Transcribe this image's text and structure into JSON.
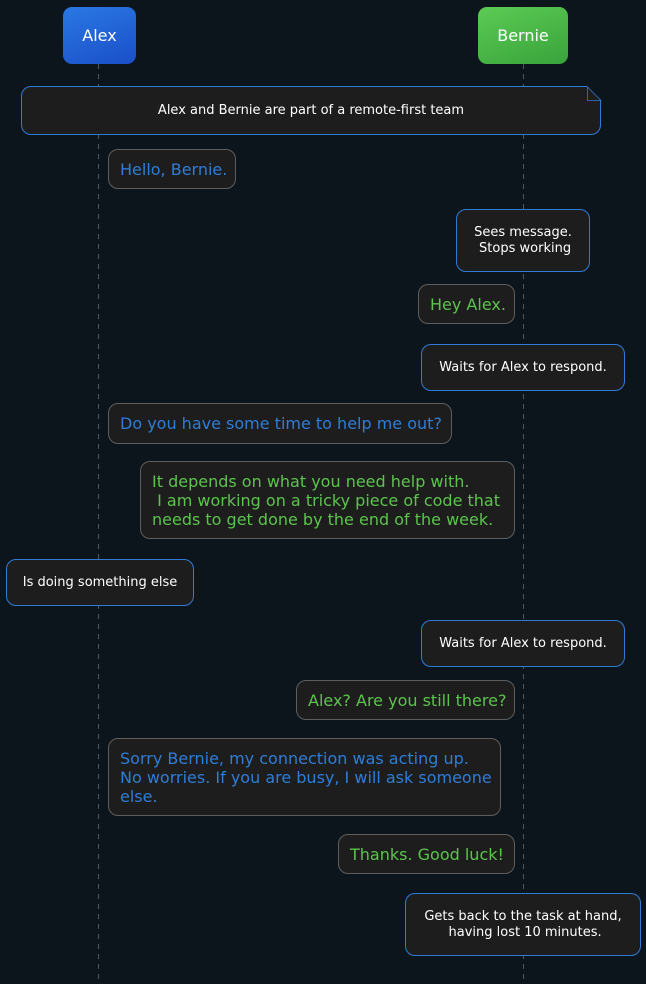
{
  "participants": {
    "alex": "Alex",
    "bernie": "Bernie"
  },
  "steps": [
    {
      "type": "note",
      "text": "Alex and Bernie are part of a remote-first team"
    },
    {
      "type": "msg",
      "from": "alex",
      "text": "Hello, Bernie."
    },
    {
      "type": "note",
      "text": "Sees message.\n Stops working"
    },
    {
      "type": "msg",
      "from": "bernie",
      "text": "Hey Alex."
    },
    {
      "type": "note",
      "text": "Waits for Alex to respond."
    },
    {
      "type": "msg",
      "from": "alex",
      "text": "Do you have some time to help me out?"
    },
    {
      "type": "msg",
      "from": "bernie",
      "text": "It depends on what you need help with.\n I am working on a tricky piece of code that\nneeds to get done by the end of the week."
    },
    {
      "type": "note",
      "text": "Is doing something else"
    },
    {
      "type": "note",
      "text": "Waits for Alex to respond."
    },
    {
      "type": "msg",
      "from": "bernie",
      "text": "Alex? Are you still there?"
    },
    {
      "type": "msg",
      "from": "alex",
      "text": "Sorry Bernie, my connection was acting up.\nNo worries. If you are busy, I will ask someone\nelse."
    },
    {
      "type": "msg",
      "from": "bernie",
      "text": "Thanks. Good luck!"
    },
    {
      "type": "note",
      "text": "Gets back to the task at hand,\n having lost 10 minutes."
    }
  ],
  "colors": {
    "background": "#0d151c",
    "alex_accent": "#2e7dd8",
    "bernie_accent": "#5bc44c",
    "note_border": "#2e7bd6",
    "bubble_fill": "#1e1d1e"
  }
}
